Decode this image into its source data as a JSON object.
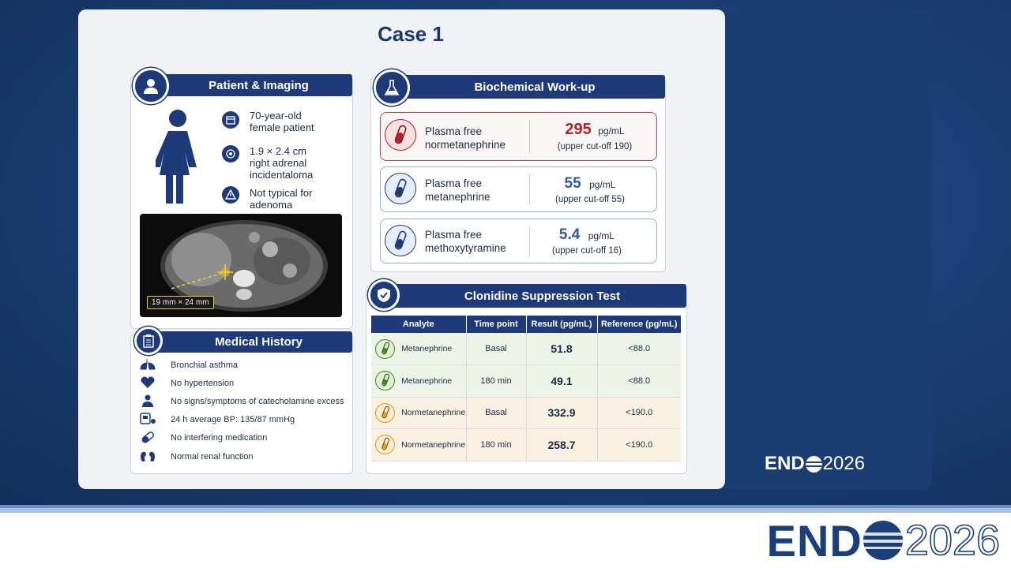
{
  "title": "Case 1",
  "brand": {
    "word": "END",
    "year": "2026"
  },
  "patient": {
    "heading": "Patient & Imaging",
    "facts": [
      {
        "icon": "calendar-icon",
        "lines": [
          "70-year-old",
          "female patient"
        ]
      },
      {
        "icon": "target-icon",
        "lines": [
          "1.9 × 2.4 cm",
          "right adrenal",
          "incidentaloma"
        ]
      },
      {
        "icon": "warning-icon",
        "lines": [
          "Not typical for",
          "adenoma"
        ]
      }
    ],
    "ct_label": "19 mm × 24 mm"
  },
  "history": {
    "heading": "Medical History",
    "items": [
      {
        "icon": "lungs-icon",
        "text": "Bronchial asthma"
      },
      {
        "icon": "heart-icon",
        "text": "No hypertension"
      },
      {
        "icon": "person-icon",
        "text": "No signs/symptoms of catecholamine excess"
      },
      {
        "icon": "bp-monitor-icon",
        "text": "24 h average BP:  135/87 mmHg"
      },
      {
        "icon": "pill-icon",
        "text": "No interfering medication"
      },
      {
        "icon": "kidney-icon",
        "text": "Normal renal function"
      }
    ]
  },
  "biochem": {
    "heading": "Biochemical Work-up",
    "rows": [
      {
        "analyte1": "Plasma free",
        "analyte2": "normetanephrine",
        "value": "295",
        "unit": "pg/mL",
        "ref": "(upper cut-off 190)",
        "status": "high"
      },
      {
        "analyte1": "Plasma free",
        "analyte2": "metanephrine",
        "value": "55",
        "unit": "pg/mL",
        "ref": "(upper cut-off 55)",
        "status": "normal"
      },
      {
        "analyte1": "Plasma free",
        "analyte2": "methoxytyramine",
        "value": "5.4",
        "unit": "pg/mL",
        "ref": "(upper cut-off 16)",
        "status": "normal"
      }
    ]
  },
  "clonidine": {
    "heading": "Clonidine Suppression Test",
    "columns": [
      "Analyte",
      "Time point",
      "Result (pg/mL)",
      "Reference (pg/mL)"
    ],
    "rows": [
      {
        "analyte": "Metanephrine",
        "time": "Basal",
        "result": "51.8",
        "reference": "<88.0",
        "tone": "green"
      },
      {
        "analyte": "Metanephrine",
        "time": "180 min",
        "result": "49.1",
        "reference": "<88.0",
        "tone": "green"
      },
      {
        "analyte": "Normetanephrine",
        "time": "Basal",
        "result": "332.9",
        "reference": "<190.0",
        "tone": "orange"
      },
      {
        "analyte": "Normetanephrine",
        "time": "180 min",
        "result": "258.7",
        "reference": "<190.0",
        "tone": "orange"
      }
    ]
  },
  "colors": {
    "navy": "#1e3a78",
    "high": "#b3202a",
    "normal": "#2d5aa8",
    "green": "#3f8a1e"
  }
}
